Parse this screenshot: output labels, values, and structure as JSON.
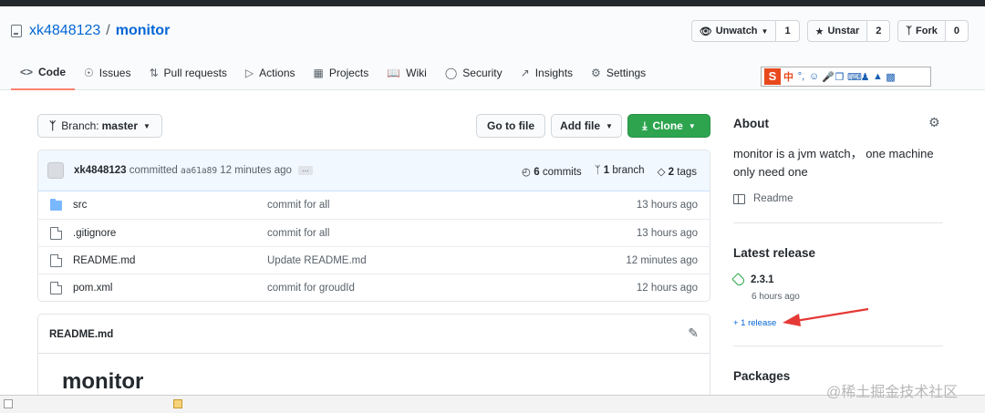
{
  "repo": {
    "owner": "xk4848123",
    "separator": "/",
    "name": "monitor"
  },
  "actions": {
    "watch": {
      "label": "Unwatch",
      "count": "1"
    },
    "star": {
      "label": "Unstar",
      "count": "2"
    },
    "fork": {
      "label": "Fork",
      "count": "0"
    }
  },
  "tabs": [
    {
      "label": "Code",
      "icon": "code-icon"
    },
    {
      "label": "Issues",
      "icon": "issue-icon"
    },
    {
      "label": "Pull requests",
      "icon": "pull-request-icon"
    },
    {
      "label": "Actions",
      "icon": "play-icon"
    },
    {
      "label": "Projects",
      "icon": "project-icon"
    },
    {
      "label": "Wiki",
      "icon": "book-icon"
    },
    {
      "label": "Security",
      "icon": "shield-icon"
    },
    {
      "label": "Insights",
      "icon": "graph-icon"
    },
    {
      "label": "Settings",
      "icon": "gear-icon"
    }
  ],
  "ime": {
    "logo": "S",
    "mode": "中"
  },
  "toolbar": {
    "branch_label": "Branch:",
    "branch": "master",
    "go_to_file": "Go to file",
    "add_file": "Add file",
    "clone": "Clone"
  },
  "commit": {
    "author": "xk4848123",
    "verb": "committed",
    "sha": "aa61a89",
    "age": "12 minutes ago",
    "more": "...",
    "commits_count": "6",
    "commits_label": "commits",
    "branch_count": "1",
    "branch_label": "branch",
    "tags_count": "2",
    "tags_label": "tags"
  },
  "files": [
    {
      "name": "src",
      "type": "folder",
      "message": "commit for all",
      "age": "13 hours ago"
    },
    {
      "name": ".gitignore",
      "type": "file",
      "message": "commit for all",
      "age": "13 hours ago"
    },
    {
      "name": "README.md",
      "type": "file",
      "message": "Update README.md",
      "age": "12 minutes ago"
    },
    {
      "name": "pom.xml",
      "type": "file",
      "message": "commit for groudId",
      "age": "12 hours ago"
    }
  ],
  "readme": {
    "filename": "README.md",
    "heading": "monitor"
  },
  "sidebar": {
    "about_title": "About",
    "description": "monitor is a jvm watch， one machine only need one",
    "readme_link": "Readme",
    "latest_release_title": "Latest release",
    "release_version": "2.3.1",
    "release_age": "6 hours ago",
    "more_releases": "+ 1 release",
    "packages_title": "Packages"
  },
  "watermark": {
    "text": "@稀土掘金技术社区"
  },
  "colors": {
    "link": "#0366d6",
    "green_button": "#2ea44f",
    "active_tab_underline": "#f9826c",
    "tag_green": "#28a745",
    "annotation_arrow": "#e53935"
  }
}
